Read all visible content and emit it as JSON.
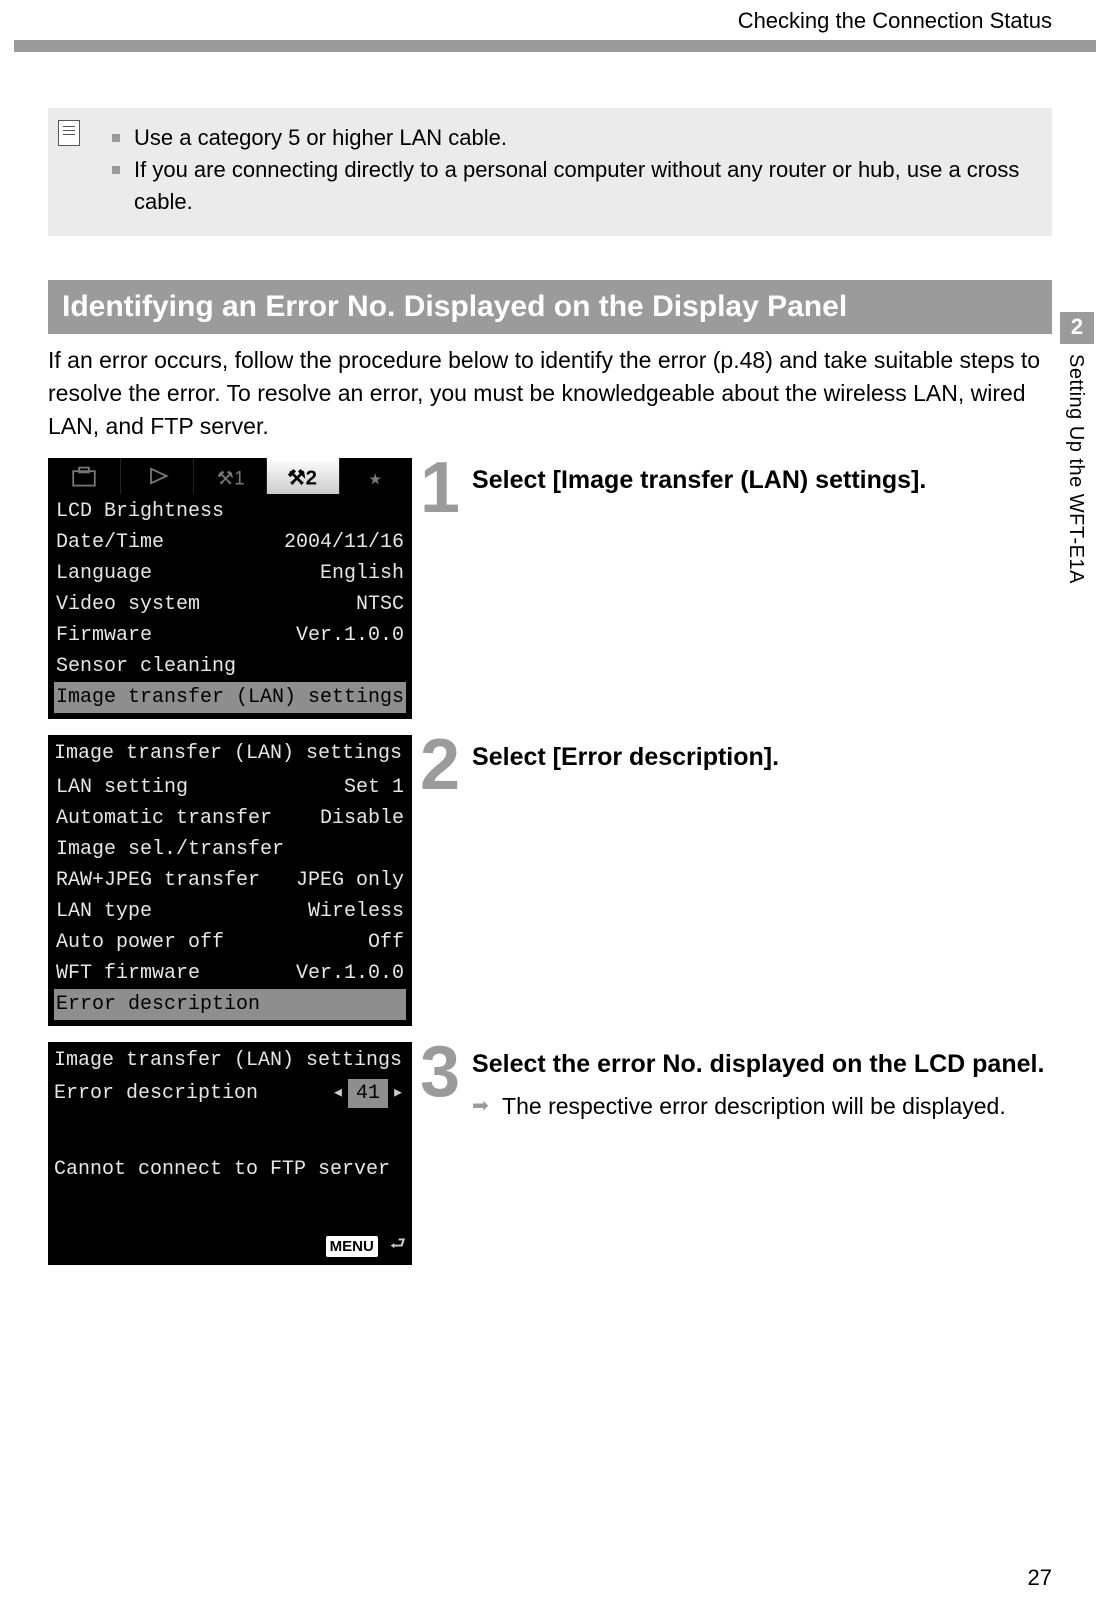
{
  "header": {
    "title": "Checking the Connection Status"
  },
  "notes": [
    "Use a category 5 or higher LAN cable.",
    "If you are connecting directly to a personal computer without any router or hub, use a cross cable."
  ],
  "section_heading": "Identifying an  Error No. Displayed on the Display Panel",
  "intro": "If an error occurs, follow the procedure below to identify the error (p.48) and take suitable steps to resolve the error. To resolve an error, you must be knowledgeable about the wireless LAN, wired LAN, and FTP server.",
  "steps": [
    {
      "num": "1",
      "title": "Select [Image transfer (LAN) settings]."
    },
    {
      "num": "2",
      "title": "Select [Error description]."
    },
    {
      "num": "3",
      "title": "Select the error No. displayed on the LCD panel.",
      "sub": "The respective error description will be displayed."
    }
  ],
  "lcd1": {
    "rows": [
      {
        "label": "LCD Brightness",
        "value": ""
      },
      {
        "label": "Date/Time",
        "value": "2004/11/16"
      },
      {
        "label": "Language",
        "value": "English"
      },
      {
        "label": "Video system",
        "value": "NTSC"
      },
      {
        "label": "Firmware",
        "value": "Ver.1.0.0"
      },
      {
        "label": "Sensor cleaning",
        "value": ""
      }
    ],
    "highlight": "Image transfer (LAN) settings"
  },
  "lcd2": {
    "title": "Image transfer (LAN) settings",
    "rows": [
      {
        "label": "LAN setting",
        "value": "Set 1"
      },
      {
        "label": "Automatic transfer",
        "value": "Disable"
      },
      {
        "label": "Image sel./transfer",
        "value": ""
      },
      {
        "label": "RAW+JPEG transfer",
        "value": "JPEG only"
      },
      {
        "label": "LAN type",
        "value": "Wireless"
      },
      {
        "label": "Auto power off",
        "value": "Off"
      },
      {
        "label": "WFT firmware",
        "value": "Ver.1.0.0"
      }
    ],
    "highlight": "Error description"
  },
  "lcd3": {
    "title": "Image transfer (LAN) settings",
    "error_label": "Error description",
    "error_no": "41",
    "message": "Cannot connect to FTP server",
    "menu": "MENU"
  },
  "side": {
    "chapter": "2",
    "label": "Setting Up the WFT-E1A"
  },
  "page_number": "27"
}
